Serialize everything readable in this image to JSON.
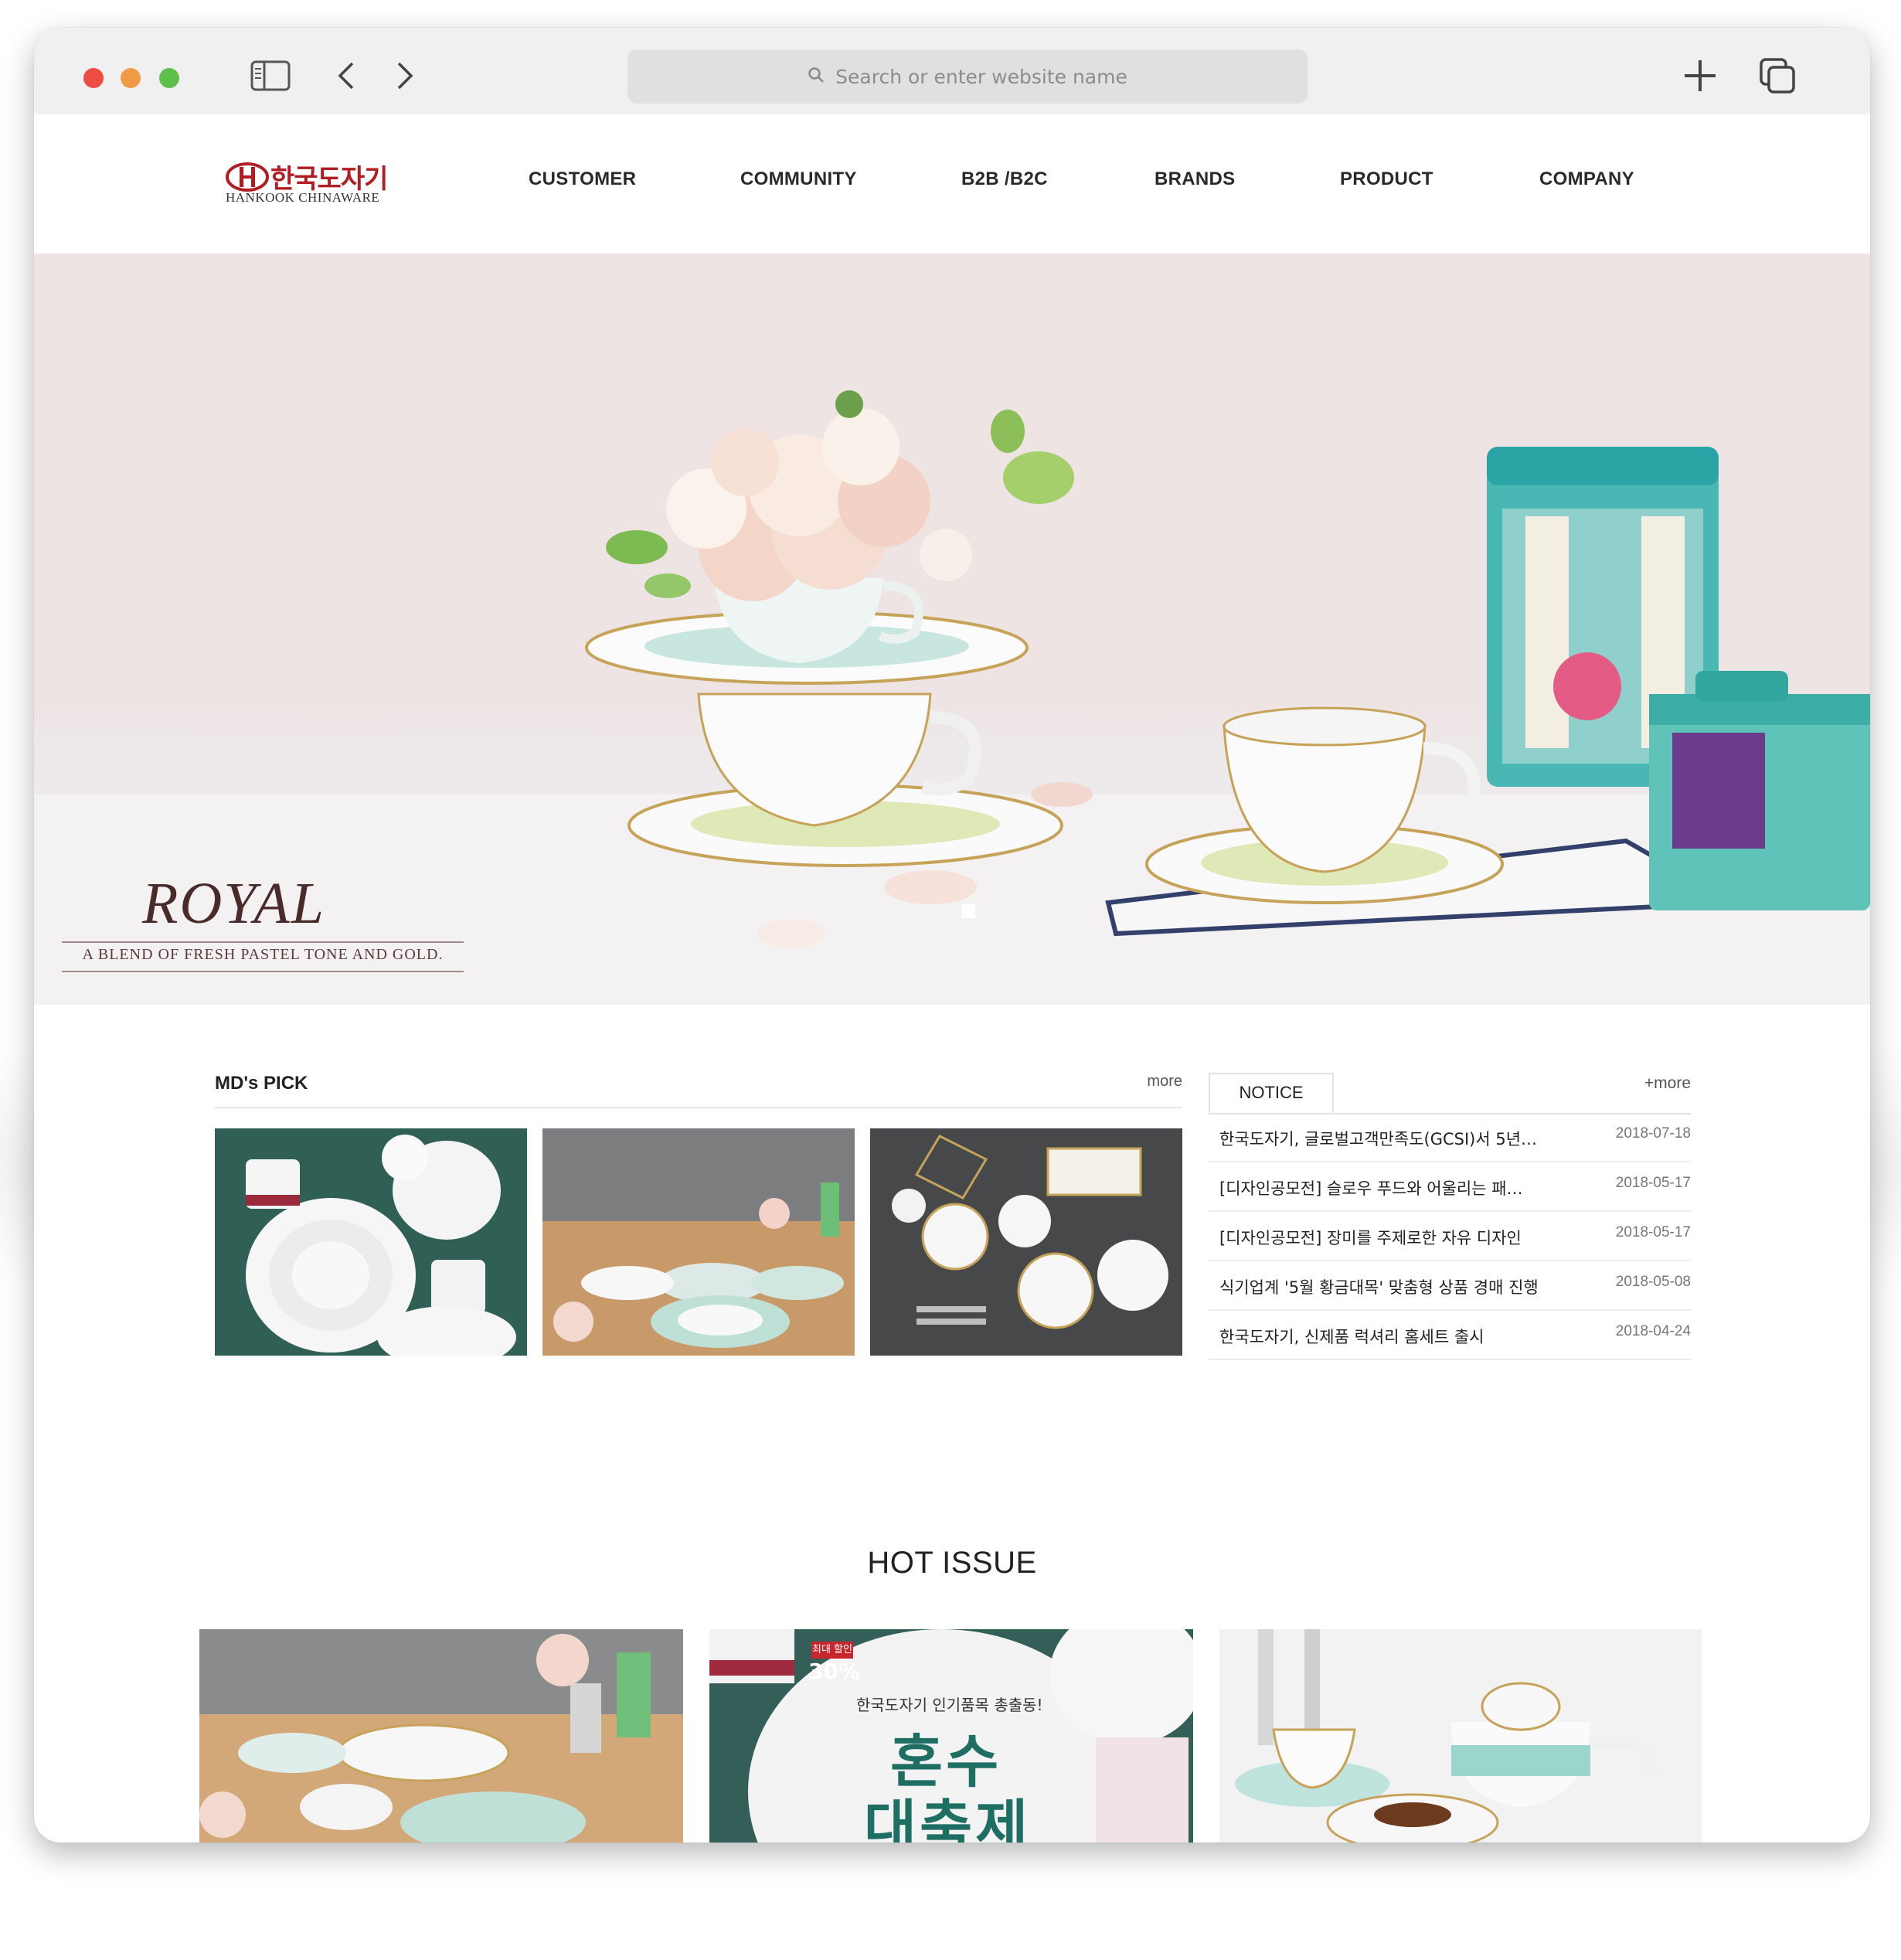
{
  "browser": {
    "address_placeholder": "Search or enter website name"
  },
  "site": {
    "logo_ko": "한국도자기",
    "logo_en": "HANKOOK CHINAWARE",
    "nav": [
      "CUSTOMER",
      "COMMUNITY",
      "B2B /B2C",
      "BRANDS",
      "PRODUCT",
      "COMPANY"
    ]
  },
  "hero": {
    "title": "ROYAL",
    "subtitle": "A BLEND OF FRESH PASTEL TONE AND GOLD."
  },
  "mds_pick": {
    "title": "MD's PICK",
    "more": "more"
  },
  "notice": {
    "tab": "NOTICE",
    "more": "+more",
    "items": [
      {
        "text": "한국도자기, 글로벌고객만족도(GCSI)서 5년…",
        "date": "2018-07-18"
      },
      {
        "text": "[디자인공모전] 슬로우 푸드와 어울리는 패…",
        "date": "2018-05-17"
      },
      {
        "text": "[디자인공모전] 장미를 주제로한 자유 디자인",
        "date": "2018-05-17"
      },
      {
        "text": "식기업계 '5월 황금대목' 맞춤형 상품 경매 진행",
        "date": "2018-05-08"
      },
      {
        "text": "한국도자기, 신제품 럭셔리 홈세트 출시",
        "date": "2018-04-24"
      }
    ]
  },
  "hot_issue": {
    "title": "HOT ISSUE",
    "banner": {
      "badge_top": "최대 할인",
      "badge_pct": "30%",
      "line1": "한국도자기 인기품목 총출동!",
      "line2": "혼수",
      "line3": "대축제"
    }
  },
  "colors": {
    "brand_red": "#b21d24",
    "teal": "#1e6e64"
  }
}
